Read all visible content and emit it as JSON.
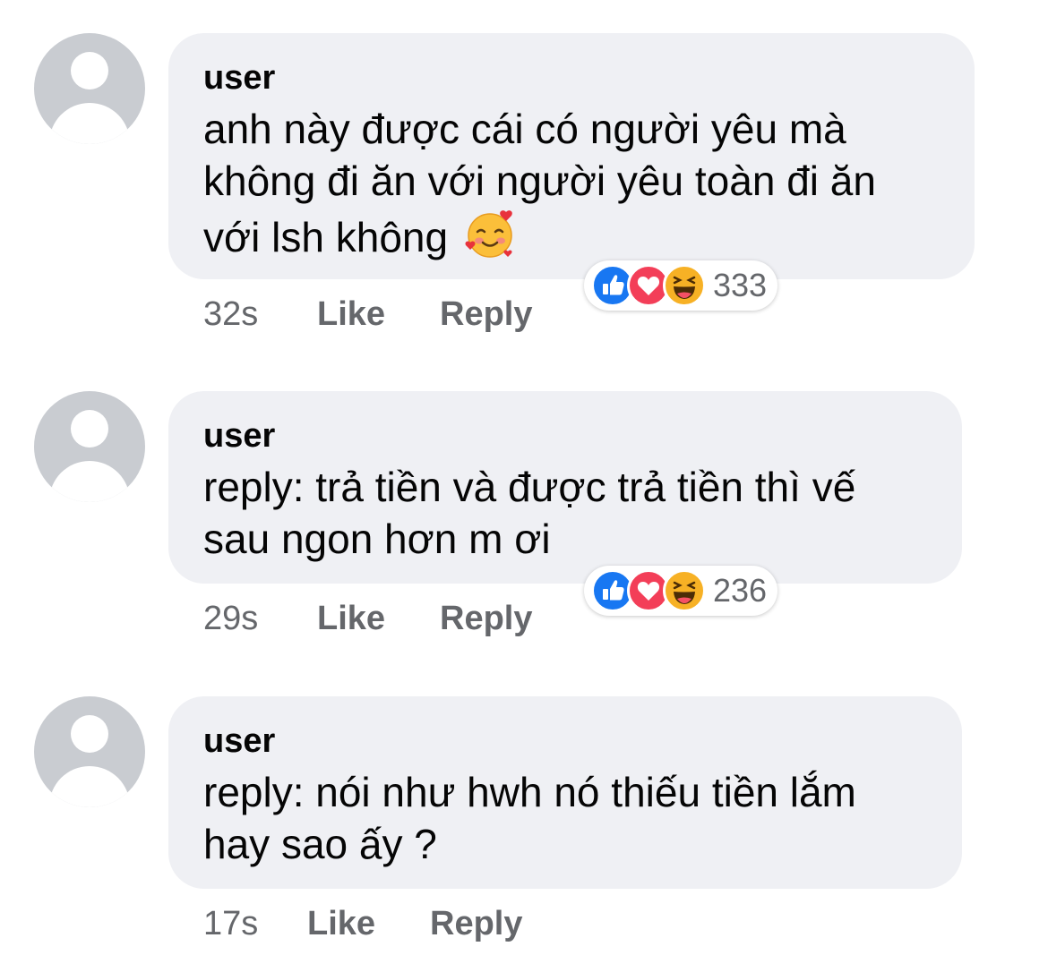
{
  "comments": [
    {
      "author": "user",
      "lines": [
        "anh này được cái có người yêu mà",
        "không đi ăn với người yêu toàn đi ăn",
        "với lsh không"
      ],
      "emoji": "smiling-face-with-hearts",
      "time": "32s",
      "like_label": "Like",
      "reply_label": "Reply",
      "reactions": {
        "icons": [
          "like",
          "love",
          "haha"
        ],
        "count": "333"
      }
    },
    {
      "author": "user",
      "lines": [
        "reply: trả tiền và được trả tiền thì vế",
        "sau ngon hơn m ơi"
      ],
      "time": "29s",
      "like_label": "Like",
      "reply_label": "Reply",
      "reactions": {
        "icons": [
          "like",
          "love",
          "haha"
        ],
        "count": "236"
      }
    },
    {
      "author": "user",
      "lines": [
        "reply: nói như hwh nó thiếu tiền lắm",
        "hay sao ấy ?"
      ],
      "time": "17s",
      "like_label": "Like",
      "reply_label": "Reply"
    }
  ],
  "colors": {
    "bubble": "#eff0f4",
    "meta_text": "#65676b",
    "like_blue": "#1877f2",
    "love_red": "#f33e58",
    "haha_yellow": "#f7b125"
  }
}
